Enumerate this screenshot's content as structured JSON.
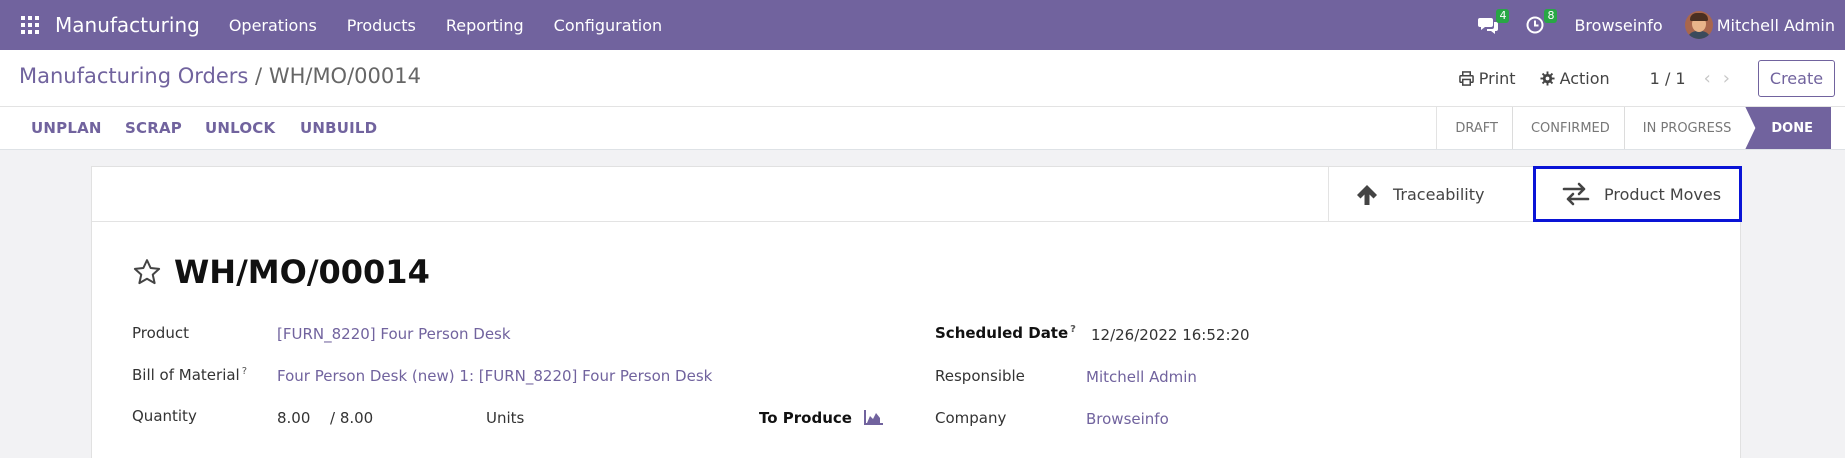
{
  "navbar": {
    "brand": "Manufacturing",
    "menu": [
      "Operations",
      "Products",
      "Reporting",
      "Configuration"
    ],
    "messages_count": "4",
    "activities_count": "8",
    "company": "Browseinfo",
    "user": "Mitchell Admin"
  },
  "control_panel": {
    "breadcrumb_parent": "Manufacturing Orders",
    "breadcrumb_sep": "/",
    "breadcrumb_current": "WH/MO/00014",
    "print_label": "Print",
    "action_label": "Action",
    "pager": "1 / 1",
    "create_label": "Create"
  },
  "statusbar": {
    "buttons": [
      "UNPLAN",
      "SCRAP",
      "UNLOCK",
      "UNBUILD"
    ],
    "stages": [
      "DRAFT",
      "CONFIRMED",
      "IN PROGRESS",
      "DONE"
    ],
    "active_stage": "DONE"
  },
  "smart_buttons": {
    "traceability": "Traceability",
    "product_moves": "Product Moves"
  },
  "form": {
    "title": "WH/MO/00014",
    "product_label": "Product",
    "product_value": "[FURN_8220] Four Person Desk",
    "bom_label": "Bill of Material",
    "bom_value": "Four Person Desk (new) 1: [FURN_8220] Four Person Desk",
    "quantity_label": "Quantity",
    "quantity_value": "8.00",
    "quantity_total": "/ 8.00",
    "quantity_uom": "Units",
    "to_produce_label": "To Produce",
    "scheduled_label": "Scheduled Date",
    "scheduled_value": "12/26/2022 16:52:20",
    "responsible_label": "Responsible",
    "responsible_value": "Mitchell Admin",
    "company_label": "Company",
    "company_value": "Browseinfo",
    "help_mark": "?"
  },
  "colors": {
    "brand": "#71639e",
    "badge": "#28a745",
    "highlight": "#0a14d6"
  }
}
